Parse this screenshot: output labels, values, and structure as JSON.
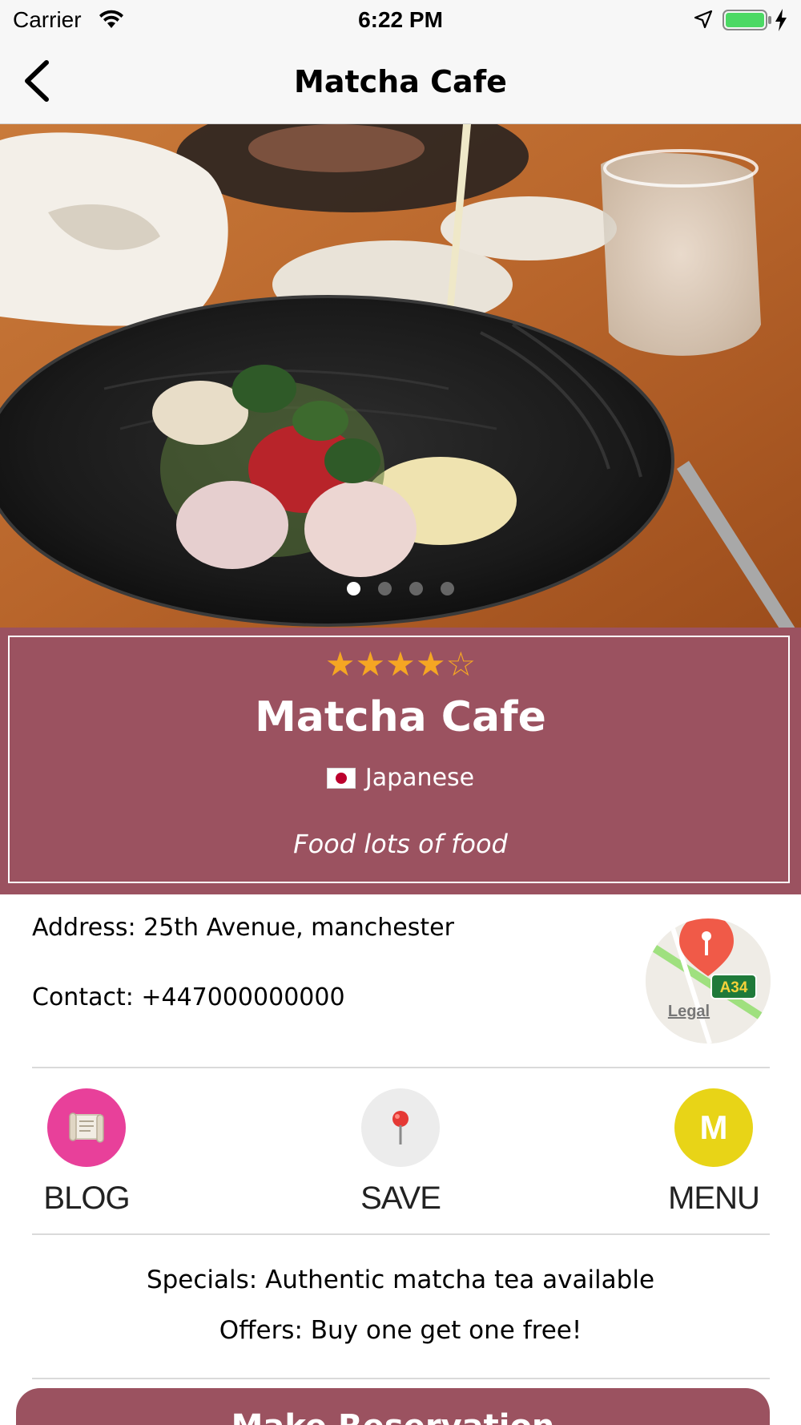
{
  "status_bar": {
    "carrier": "Carrier",
    "time": "6:22 PM"
  },
  "nav": {
    "title": "Matcha Cafe",
    "back_icon": "chevron-left-icon"
  },
  "gallery": {
    "page_count": 4,
    "current_page": 1
  },
  "restaurant": {
    "rating": 4,
    "rating_max": 5,
    "stars_text": "★★★★☆",
    "name": "Matcha Cafe",
    "cuisine_flag_icon": "japan-flag-icon",
    "cuisine": "Japanese",
    "tagline": "Food lots of food"
  },
  "details": {
    "address": "Address: 25th Avenue, manchester",
    "contact": "Contact: +447000000000",
    "map_road_label": "A34",
    "map_legal": "Legal"
  },
  "actions": [
    {
      "label": "BLOG",
      "icon": "scroll-icon",
      "color": "#e8409a"
    },
    {
      "label": "SAVE",
      "icon": "pushpin-icon",
      "color": "#ececec"
    },
    {
      "label": "MENU",
      "icon": "menu-letter-icon",
      "letter": "M",
      "color": "#e8d417"
    }
  ],
  "info": {
    "specials": "Specials: Authentic matcha tea available",
    "offers": "Offers: Buy one get one free!"
  },
  "reservation": {
    "label": "Make Reservation"
  },
  "colors": {
    "brand": "#9b5260",
    "star": "#f5a623"
  }
}
